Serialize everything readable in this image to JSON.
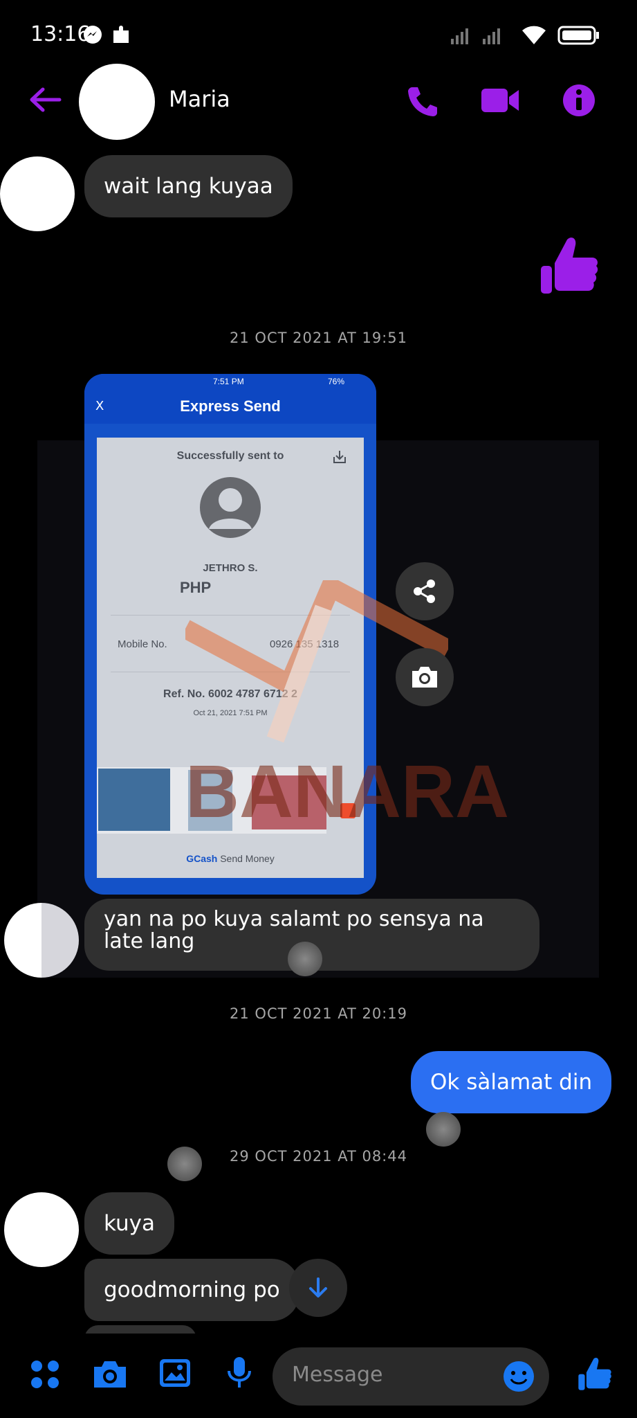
{
  "status_bar": {
    "time": "13:16"
  },
  "header": {
    "contact_name": "Maria"
  },
  "messages": {
    "m1": "wait lang kuyaa",
    "ts1": "21 OCT 2021 AT 19:51",
    "m2": "yan na po kuya salamt po sensya na late lang",
    "ts2": "21 OCT 2021 AT 20:19",
    "m3": "Ok sàlamat din",
    "ts3": "29 OCT 2021 AT 08:44",
    "m4": "kuya",
    "m5": "goodmorning po"
  },
  "receipt": {
    "phone_time": "7:51 PM",
    "battery": "76%",
    "close": "X",
    "title": "Express Send",
    "sent_to": "Successfully sent to",
    "recipient": "JETHRO S.",
    "currency": "PHP",
    "mobile_label": "Mobile No.",
    "mobile_value": "0926 135 1318",
    "ref": "Ref. No. 6002 4787 6712 2",
    "date": "Oct 21, 2021 7:51 PM",
    "footer_brand": "GCash",
    "footer_text": "Send Money",
    "watermark": "BANARA"
  },
  "composer": {
    "placeholder": "Message"
  },
  "colors": {
    "accent": "#9b1fe8",
    "blue": "#2b6ff2",
    "bubble": "#303030",
    "icon_blue": "#1877f2"
  }
}
